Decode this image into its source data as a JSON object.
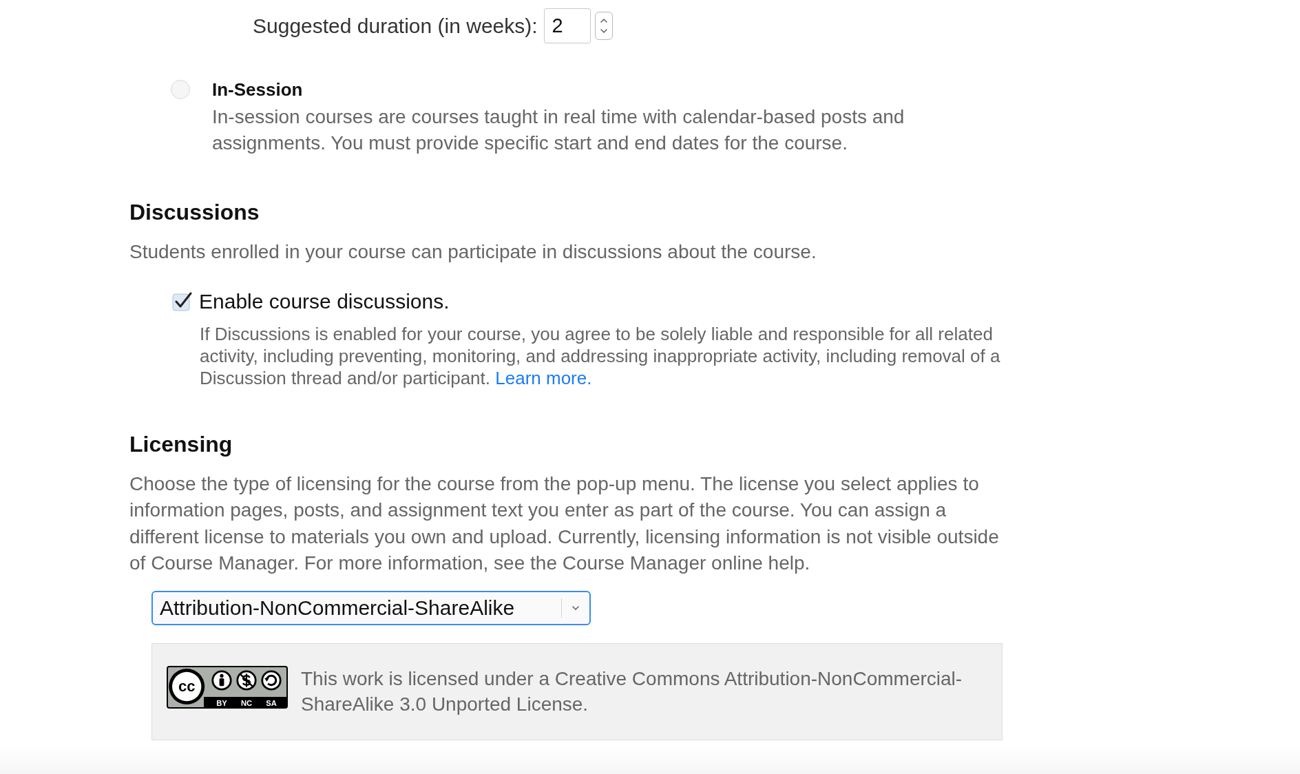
{
  "duration": {
    "label": "Suggested duration (in weeks):",
    "value": "2"
  },
  "course_types": [
    {
      "title": "In-Session",
      "description": "In-session courses are courses taught in real time with calendar-based posts and assignments. You must provide specific start and end dates for the course.",
      "selected": false
    }
  ],
  "discussions": {
    "heading": "Discussions",
    "description": "Students enrolled in your course can participate in discussions about the course.",
    "option": {
      "label": "Enable course discussions.",
      "checked": true,
      "note": "If Discussions is enabled for your course, you agree to be solely liable and responsible for all related activity, including preventing, monitoring, and addressing inappropriate activity, including removal of a Discussion thread and/or participant.",
      "link": "Learn more."
    }
  },
  "licensing": {
    "heading": "Licensing",
    "description": "Choose the type of licensing for the course from the pop-up menu. The license you select applies to information pages, posts, and assignment text you enter as part of the course. You can assign a different license to materials you own and upload. Currently, licensing information is not visible outside of Course Manager. For more information, see the Course Manager online help.",
    "select": {
      "value": "Attribution-NonCommercial-ShareAlike"
    },
    "notice": {
      "badge": {
        "symbol": "cc",
        "terms": [
          "BY",
          "NC",
          "SA"
        ]
      },
      "text": "This work is licensed under a Creative Commons Attribution-NonCommercial-ShareAlike 3.0 Unported License."
    }
  }
}
